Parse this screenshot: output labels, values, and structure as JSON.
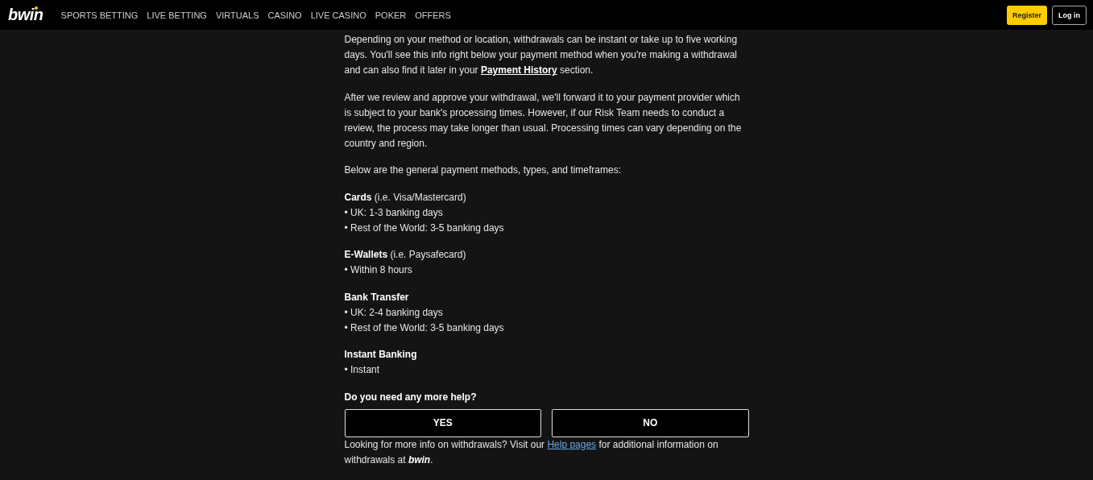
{
  "header": {
    "logo": "bwin",
    "nav": [
      {
        "label": "SPORTS BETTING"
      },
      {
        "label": "LIVE BETTING"
      },
      {
        "label": "VIRTUALS"
      },
      {
        "label": "CASINO"
      },
      {
        "label": "LIVE CASINO"
      },
      {
        "label": "POKER"
      },
      {
        "label": "OFFERS"
      }
    ],
    "register": "Register",
    "login": "Log in"
  },
  "intro": {
    "before": "Depending on your method or location, withdrawals can be instant or take up to five working days. You'll see this info right below your payment method when you're making a withdrawal and can also find it later in your ",
    "link": "Payment History",
    "after": " section."
  },
  "paragraphs": [
    "After we review and approve your withdrawal, we'll forward it to your payment provider which is subject to your bank's processing times. However, if our Risk Team needs to conduct a review, the process may take longer than usual. Processing times can vary depending on the country and region.",
    "Below are the general payment methods, types, and timeframes:"
  ],
  "methods": [
    {
      "title": "**Cards** (i.e. Visa/Mastercard)",
      "lines": [
        "• UK: 1-3 banking days",
        "• Rest of the World: 3-5 banking days"
      ]
    },
    {
      "title": "**E-Wallets** (i.e. Paysafecard)",
      "lines": [
        "• Within 8 hours"
      ]
    },
    {
      "title": "**Bank Transfer**",
      "lines": [
        "• UK: 2-4 banking days",
        "• Rest of the World: 3-5 banking days"
      ]
    },
    {
      "title": "**Instant Banking**",
      "lines": [
        "• Instant"
      ]
    }
  ],
  "help": {
    "question": "Do you need any more help?",
    "buttons": [
      "YES",
      "NO"
    ]
  },
  "footer": {
    "before": "Looking for more info on withdrawals? Visit our ",
    "link": "Help pages",
    "after": " for additional information on withdrawals at *bwin*."
  }
}
